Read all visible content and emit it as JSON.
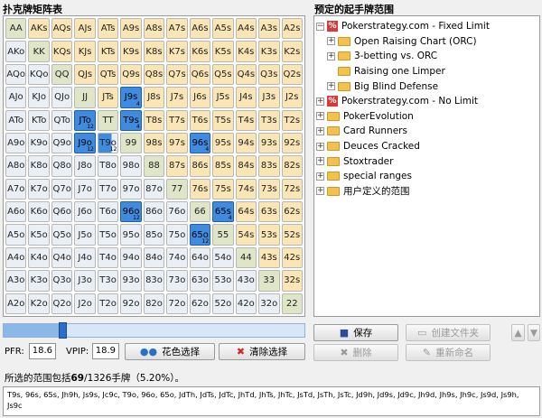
{
  "grid_title": "扑克牌矩阵表",
  "tree_title": "预定的起手牌范围",
  "grid": {
    "cells": [
      {
        "label": "AA",
        "type": "pair"
      },
      {
        "label": "AKs",
        "type": "suited"
      },
      {
        "label": "AQs",
        "type": "suited"
      },
      {
        "label": "AJs",
        "type": "suited"
      },
      {
        "label": "ATs",
        "type": "suited"
      },
      {
        "label": "A9s",
        "type": "suited"
      },
      {
        "label": "A8s",
        "type": "suited"
      },
      {
        "label": "A7s",
        "type": "suited"
      },
      {
        "label": "A6s",
        "type": "suited"
      },
      {
        "label": "A5s",
        "type": "suited"
      },
      {
        "label": "A4s",
        "type": "suited"
      },
      {
        "label": "A3s",
        "type": "suited"
      },
      {
        "label": "A2s",
        "type": "suited"
      },
      {
        "label": "AKo",
        "type": "offsuit"
      },
      {
        "label": "KK",
        "type": "pair"
      },
      {
        "label": "KQs",
        "type": "suited"
      },
      {
        "label": "KJs",
        "type": "suited"
      },
      {
        "label": "KTs",
        "type": "suited"
      },
      {
        "label": "K9s",
        "type": "suited"
      },
      {
        "label": "K8s",
        "type": "suited"
      },
      {
        "label": "K7s",
        "type": "suited"
      },
      {
        "label": "K6s",
        "type": "suited"
      },
      {
        "label": "K5s",
        "type": "suited"
      },
      {
        "label": "K4s",
        "type": "suited"
      },
      {
        "label": "K3s",
        "type": "suited"
      },
      {
        "label": "K2s",
        "type": "suited"
      },
      {
        "label": "AQo",
        "type": "offsuit"
      },
      {
        "label": "KQo",
        "type": "offsuit"
      },
      {
        "label": "QQ",
        "type": "pair"
      },
      {
        "label": "QJs",
        "type": "suited"
      },
      {
        "label": "QTs",
        "type": "suited"
      },
      {
        "label": "Q9s",
        "type": "suited"
      },
      {
        "label": "Q8s",
        "type": "suited"
      },
      {
        "label": "Q7s",
        "type": "suited"
      },
      {
        "label": "Q6s",
        "type": "suited"
      },
      {
        "label": "Q5s",
        "type": "suited"
      },
      {
        "label": "Q4s",
        "type": "suited"
      },
      {
        "label": "Q3s",
        "type": "suited"
      },
      {
        "label": "Q2s",
        "type": "suited"
      },
      {
        "label": "AJo",
        "type": "offsuit"
      },
      {
        "label": "KJo",
        "type": "offsuit"
      },
      {
        "label": "QJo",
        "type": "offsuit"
      },
      {
        "label": "JJ",
        "type": "pair"
      },
      {
        "label": "JTs",
        "type": "suited"
      },
      {
        "label": "J9s",
        "type": "suited",
        "state": "selected",
        "count": "4"
      },
      {
        "label": "J8s",
        "type": "suited"
      },
      {
        "label": "J7s",
        "type": "suited"
      },
      {
        "label": "J6s",
        "type": "suited"
      },
      {
        "label": "J5s",
        "type": "suited"
      },
      {
        "label": "J4s",
        "type": "suited"
      },
      {
        "label": "J3s",
        "type": "suited"
      },
      {
        "label": "J2s",
        "type": "suited"
      },
      {
        "label": "ATo",
        "type": "offsuit"
      },
      {
        "label": "KTo",
        "type": "offsuit"
      },
      {
        "label": "QTo",
        "type": "offsuit"
      },
      {
        "label": "JTo",
        "type": "offsuit",
        "state": "selected",
        "count": "12"
      },
      {
        "label": "TT",
        "type": "pair"
      },
      {
        "label": "T9s",
        "type": "suited",
        "state": "selected",
        "count": "4"
      },
      {
        "label": "T8s",
        "type": "suited"
      },
      {
        "label": "T7s",
        "type": "suited"
      },
      {
        "label": "T6s",
        "type": "suited"
      },
      {
        "label": "T5s",
        "type": "suited"
      },
      {
        "label": "T4s",
        "type": "suited"
      },
      {
        "label": "T3s",
        "type": "suited"
      },
      {
        "label": "T2s",
        "type": "suited"
      },
      {
        "label": "A9o",
        "type": "offsuit"
      },
      {
        "label": "K9o",
        "type": "offsuit"
      },
      {
        "label": "Q9o",
        "type": "offsuit"
      },
      {
        "label": "J9o",
        "type": "offsuit",
        "state": "selected",
        "count": "12"
      },
      {
        "label": "T9o",
        "type": "offsuit",
        "state": "partial",
        "count": "12"
      },
      {
        "label": "99",
        "type": "pair"
      },
      {
        "label": "98s",
        "type": "suited"
      },
      {
        "label": "97s",
        "type": "suited"
      },
      {
        "label": "96s",
        "type": "suited",
        "state": "selected",
        "count": "4"
      },
      {
        "label": "95s",
        "type": "suited"
      },
      {
        "label": "94s",
        "type": "suited"
      },
      {
        "label": "93s",
        "type": "suited"
      },
      {
        "label": "92s",
        "type": "suited"
      },
      {
        "label": "A8o",
        "type": "offsuit"
      },
      {
        "label": "K8o",
        "type": "offsuit"
      },
      {
        "label": "Q8o",
        "type": "offsuit"
      },
      {
        "label": "J8o",
        "type": "offsuit"
      },
      {
        "label": "T8o",
        "type": "offsuit"
      },
      {
        "label": "98o",
        "type": "offsuit"
      },
      {
        "label": "88",
        "type": "pair"
      },
      {
        "label": "87s",
        "type": "suited"
      },
      {
        "label": "86s",
        "type": "suited"
      },
      {
        "label": "85s",
        "type": "suited"
      },
      {
        "label": "84s",
        "type": "suited"
      },
      {
        "label": "83s",
        "type": "suited"
      },
      {
        "label": "82s",
        "type": "suited"
      },
      {
        "label": "A7o",
        "type": "offsuit"
      },
      {
        "label": "K7o",
        "type": "offsuit"
      },
      {
        "label": "Q7o",
        "type": "offsuit"
      },
      {
        "label": "J7o",
        "type": "offsuit"
      },
      {
        "label": "T7o",
        "type": "offsuit"
      },
      {
        "label": "97o",
        "type": "offsuit"
      },
      {
        "label": "87o",
        "type": "offsuit"
      },
      {
        "label": "77",
        "type": "pair"
      },
      {
        "label": "76s",
        "type": "suited"
      },
      {
        "label": "75s",
        "type": "suited"
      },
      {
        "label": "74s",
        "type": "suited"
      },
      {
        "label": "73s",
        "type": "suited"
      },
      {
        "label": "72s",
        "type": "suited"
      },
      {
        "label": "A6o",
        "type": "offsuit"
      },
      {
        "label": "K6o",
        "type": "offsuit"
      },
      {
        "label": "Q6o",
        "type": "offsuit"
      },
      {
        "label": "J6o",
        "type": "offsuit"
      },
      {
        "label": "T6o",
        "type": "offsuit"
      },
      {
        "label": "96o",
        "type": "offsuit",
        "state": "selected",
        "count": "12"
      },
      {
        "label": "86o",
        "type": "offsuit"
      },
      {
        "label": "76o",
        "type": "offsuit"
      },
      {
        "label": "66",
        "type": "pair"
      },
      {
        "label": "65s",
        "type": "suited",
        "state": "selected",
        "count": "4"
      },
      {
        "label": "64s",
        "type": "suited"
      },
      {
        "label": "63s",
        "type": "suited"
      },
      {
        "label": "62s",
        "type": "suited"
      },
      {
        "label": "A5o",
        "type": "offsuit"
      },
      {
        "label": "K5o",
        "type": "offsuit"
      },
      {
        "label": "Q5o",
        "type": "offsuit"
      },
      {
        "label": "J5o",
        "type": "offsuit"
      },
      {
        "label": "T5o",
        "type": "offsuit"
      },
      {
        "label": "95o",
        "type": "offsuit"
      },
      {
        "label": "85o",
        "type": "offsuit"
      },
      {
        "label": "75o",
        "type": "offsuit"
      },
      {
        "label": "65o",
        "type": "offsuit",
        "state": "selected",
        "count": "12"
      },
      {
        "label": "55",
        "type": "pair"
      },
      {
        "label": "54s",
        "type": "suited"
      },
      {
        "label": "53s",
        "type": "suited"
      },
      {
        "label": "52s",
        "type": "suited"
      },
      {
        "label": "A4o",
        "type": "offsuit"
      },
      {
        "label": "K4o",
        "type": "offsuit"
      },
      {
        "label": "Q4o",
        "type": "offsuit"
      },
      {
        "label": "J4o",
        "type": "offsuit"
      },
      {
        "label": "T4o",
        "type": "offsuit"
      },
      {
        "label": "94o",
        "type": "offsuit"
      },
      {
        "label": "84o",
        "type": "offsuit"
      },
      {
        "label": "74o",
        "type": "offsuit"
      },
      {
        "label": "64o",
        "type": "offsuit"
      },
      {
        "label": "54o",
        "type": "offsuit"
      },
      {
        "label": "44",
        "type": "pair"
      },
      {
        "label": "43s",
        "type": "suited"
      },
      {
        "label": "42s",
        "type": "suited"
      },
      {
        "label": "A3o",
        "type": "offsuit"
      },
      {
        "label": "K3o",
        "type": "offsuit"
      },
      {
        "label": "Q3o",
        "type": "offsuit"
      },
      {
        "label": "J3o",
        "type": "offsuit"
      },
      {
        "label": "T3o",
        "type": "offsuit"
      },
      {
        "label": "93o",
        "type": "offsuit"
      },
      {
        "label": "83o",
        "type": "offsuit"
      },
      {
        "label": "73o",
        "type": "offsuit"
      },
      {
        "label": "63o",
        "type": "offsuit"
      },
      {
        "label": "53o",
        "type": "offsuit"
      },
      {
        "label": "43o",
        "type": "offsuit"
      },
      {
        "label": "33",
        "type": "pair"
      },
      {
        "label": "32s",
        "type": "suited"
      },
      {
        "label": "A2o",
        "type": "offsuit"
      },
      {
        "label": "K2o",
        "type": "offsuit"
      },
      {
        "label": "Q2o",
        "type": "offsuit"
      },
      {
        "label": "J2o",
        "type": "offsuit"
      },
      {
        "label": "T2o",
        "type": "offsuit"
      },
      {
        "label": "92o",
        "type": "offsuit"
      },
      {
        "label": "82o",
        "type": "offsuit"
      },
      {
        "label": "72o",
        "type": "offsuit"
      },
      {
        "label": "62o",
        "type": "offsuit"
      },
      {
        "label": "52o",
        "type": "offsuit"
      },
      {
        "label": "42o",
        "type": "offsuit"
      },
      {
        "label": "32o",
        "type": "offsuit"
      },
      {
        "label": "22",
        "type": "pair"
      }
    ]
  },
  "tree": {
    "nodes": [
      {
        "label": "Pokerstrategy.com - Fixed Limit",
        "icon": "pokerstrategy-logo-icon",
        "expander": "−",
        "level": 1
      },
      {
        "label": "Open Raising Chart (ORC)",
        "icon": "folder-icon",
        "expander": "+",
        "level": 2
      },
      {
        "label": "3-betting vs. ORC",
        "icon": "folder-icon",
        "expander": "+",
        "level": 2
      },
      {
        "label": "Raising one Limper",
        "icon": "folder-icon",
        "expander": "",
        "level": 2
      },
      {
        "label": "Big Blind Defense",
        "icon": "folder-icon",
        "expander": "+",
        "level": 2
      },
      {
        "label": "Pokerstrategy.com - No Limit",
        "icon": "pokerstrategy-logo-icon",
        "expander": "+",
        "level": 1
      },
      {
        "label": "PokerEvolution",
        "icon": "folder-icon",
        "expander": "+",
        "level": 1
      },
      {
        "label": "Card Runners",
        "icon": "folder-icon",
        "expander": "+",
        "level": 1
      },
      {
        "label": "Deuces Cracked",
        "icon": "folder-icon",
        "expander": "+",
        "level": 1
      },
      {
        "label": "Stoxtrader",
        "icon": "folder-icon",
        "expander": "+",
        "level": 1
      },
      {
        "label": "special ranges",
        "icon": "folder-icon",
        "expander": "+",
        "level": 1
      },
      {
        "label": "用户定义的范围",
        "icon": "folder-icon",
        "expander": "+",
        "level": 1
      }
    ]
  },
  "slider": {
    "level_fraction": 0.198
  },
  "controls": {
    "pfr_label": "PFR:",
    "pfr_value": "18.6",
    "vpip_label": "VPIP:",
    "vpip_value": "18.9",
    "suit_select_label": "花色选择",
    "clear_select_label": "清除选择",
    "save_label": "保存",
    "delete_label": "删除",
    "create_folder_label": "创建文件夹",
    "rename_label": "重新命名"
  },
  "summary": {
    "prefix": "所选的范围包括",
    "count": "69",
    "suffix": "/1326手牌（5.20%）。"
  },
  "hands_text": "T9s, 96s, 65s, Jh9h, Js9s, Jc9c, T9o, 96o, 65o, JdTh, JdTs, JdTc, JhTd, JhTs, JhTc, JsTd, JsTh, JsTc, Jd9h, Jd9s, Jd9c, Jh9d, Jh9s, Jh9c, Js9d, Js9h, Js9c",
  "colors": {
    "selected": "#3e8be0",
    "pair": "#dfe6c8",
    "suited": "#fae6b5",
    "offsuit": "#e9eff5"
  }
}
